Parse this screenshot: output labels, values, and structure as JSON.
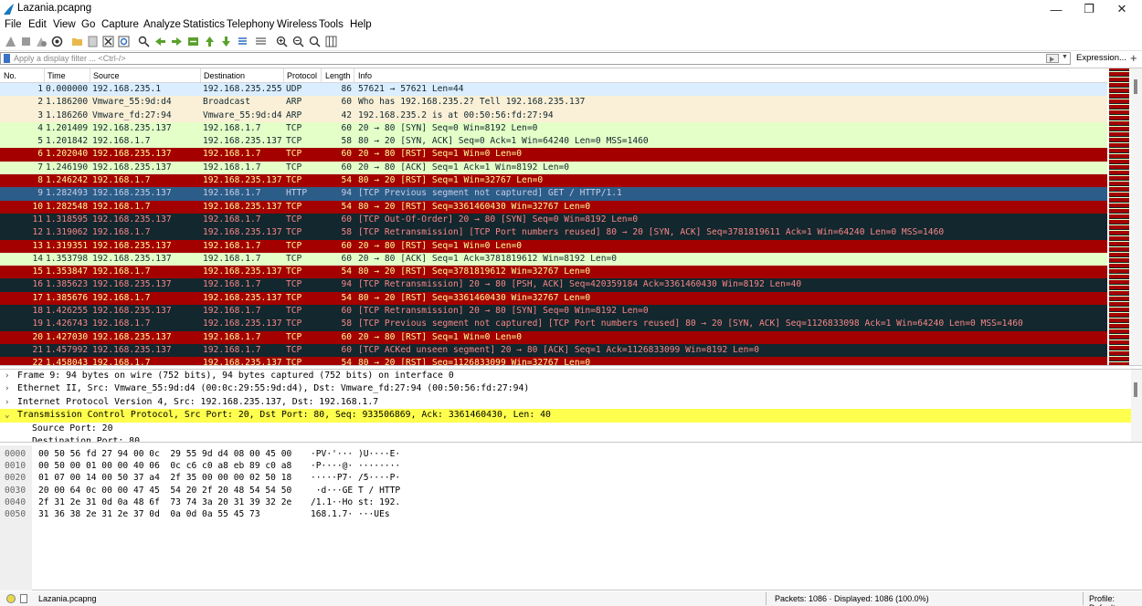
{
  "window": {
    "title": "Lazania.pcapng",
    "minimize_glyph": "—",
    "maximize_glyph": "❐",
    "close_glyph": "✕"
  },
  "menu": [
    "File",
    "Edit",
    "View",
    "Go",
    "Capture",
    "Analyze",
    "Statistics",
    "Telephony",
    "Wireless",
    "Tools",
    "Help"
  ],
  "toolbar_icons": [
    "start-capture-icon",
    "stop-capture-icon",
    "restart-capture-icon",
    "capture-options-icon",
    "open-file-icon",
    "save-file-icon",
    "close-file-icon",
    "reload-file-icon",
    "find-packet-icon",
    "go-back-icon",
    "go-forward-icon",
    "go-to-packet-icon",
    "go-first-icon",
    "go-last-icon",
    "autoscroll-icon",
    "colorize-icon",
    "zoom-in-icon",
    "zoom-out-icon",
    "normal-size-icon",
    "resize-columns-icon"
  ],
  "filter": {
    "placeholder": "Apply a display filter ... <Ctrl-/>",
    "expression_label": "Expression...",
    "plus_label": "+"
  },
  "packet_list": {
    "columns": [
      "No.",
      "Time",
      "Source",
      "Destination",
      "Protocol",
      "Length",
      "Info"
    ],
    "rows": [
      {
        "no": "1",
        "time": "0.000000",
        "src": "192.168.235.1",
        "dst": "192.168.235.255",
        "proto": "UDP",
        "len": "86",
        "info": "57621 → 57621 Len=44",
        "style": "udp"
      },
      {
        "no": "2",
        "time": "1.186200",
        "src": "Vmware_55:9d:d4",
        "dst": "Broadcast",
        "proto": "ARP",
        "len": "60",
        "info": "Who has 192.168.235.2? Tell 192.168.235.137",
        "style": "arp"
      },
      {
        "no": "3",
        "time": "1.186260",
        "src": "Vmware_fd:27:94",
        "dst": "Vmware_55:9d:d4",
        "proto": "ARP",
        "len": "42",
        "info": "192.168.235.2 is at 00:50:56:fd:27:94",
        "style": "arp"
      },
      {
        "no": "4",
        "time": "1.201409",
        "src": "192.168.235.137",
        "dst": "192.168.1.7",
        "proto": "TCP",
        "len": "60",
        "info": "20 → 80 [SYN] Seq=0 Win=8192 Len=0",
        "style": "syn"
      },
      {
        "no": "5",
        "time": "1.201842",
        "src": "192.168.1.7",
        "dst": "192.168.235.137",
        "proto": "TCP",
        "len": "58",
        "info": "80 → 20 [SYN, ACK] Seq=0 Ack=1 Win=64240 Len=0 MSS=1460",
        "style": "syn"
      },
      {
        "no": "6",
        "time": "1.202040",
        "src": "192.168.235.137",
        "dst": "192.168.1.7",
        "proto": "TCP",
        "len": "60",
        "info": "20 → 80 [RST] Seq=1 Win=0 Len=0",
        "style": "rst"
      },
      {
        "no": "7",
        "time": "1.246190",
        "src": "192.168.235.137",
        "dst": "192.168.1.7",
        "proto": "TCP",
        "len": "60",
        "info": "20 → 80 [ACK] Seq=1 Ack=1 Win=8192 Len=0",
        "style": "syn"
      },
      {
        "no": "8",
        "time": "1.246242",
        "src": "192.168.1.7",
        "dst": "192.168.235.137",
        "proto": "TCP",
        "len": "54",
        "info": "80 → 20 [RST] Seq=1 Win=32767 Len=0",
        "style": "rst"
      },
      {
        "no": "9",
        "time": "1.282493",
        "src": "192.168.235.137",
        "dst": "192.168.1.7",
        "proto": "HTTP",
        "len": "94",
        "info": "[TCP Previous segment not captured] GET / HTTP/1.1",
        "style": "sel"
      },
      {
        "no": "10",
        "time": "1.282548",
        "src": "192.168.1.7",
        "dst": "192.168.235.137",
        "proto": "TCP",
        "len": "54",
        "info": "80 → 20 [RST] Seq=3361460430 Win=32767 Len=0",
        "style": "rst"
      },
      {
        "no": "11",
        "time": "1.318595",
        "src": "192.168.235.137",
        "dst": "192.168.1.7",
        "proto": "TCP",
        "len": "60",
        "info": "[TCP Out-Of-Order] 20 → 80 [SYN] Seq=0 Win=8192 Len=0",
        "style": "bad"
      },
      {
        "no": "12",
        "time": "1.319062",
        "src": "192.168.1.7",
        "dst": "192.168.235.137",
        "proto": "TCP",
        "len": "58",
        "info": "[TCP Retransmission] [TCP Port numbers reused] 80 → 20 [SYN, ACK] Seq=3781819611 Ack=1 Win=64240 Len=0 MSS=1460",
        "style": "bad"
      },
      {
        "no": "13",
        "time": "1.319351",
        "src": "192.168.235.137",
        "dst": "192.168.1.7",
        "proto": "TCP",
        "len": "60",
        "info": "20 → 80 [RST] Seq=1 Win=0 Len=0",
        "style": "rst"
      },
      {
        "no": "14",
        "time": "1.353798",
        "src": "192.168.235.137",
        "dst": "192.168.1.7",
        "proto": "TCP",
        "len": "60",
        "info": "20 → 80 [ACK] Seq=1 Ack=3781819612 Win=8192 Len=0",
        "style": "syn"
      },
      {
        "no": "15",
        "time": "1.353847",
        "src": "192.168.1.7",
        "dst": "192.168.235.137",
        "proto": "TCP",
        "len": "54",
        "info": "80 → 20 [RST] Seq=3781819612 Win=32767 Len=0",
        "style": "rst"
      },
      {
        "no": "16",
        "time": "1.385623",
        "src": "192.168.235.137",
        "dst": "192.168.1.7",
        "proto": "TCP",
        "len": "94",
        "info": "[TCP Retransmission] 20 → 80 [PSH, ACK] Seq=420359184 Ack=3361460430 Win=8192 Len=40",
        "style": "bad"
      },
      {
        "no": "17",
        "time": "1.385676",
        "src": "192.168.1.7",
        "dst": "192.168.235.137",
        "proto": "TCP",
        "len": "54",
        "info": "80 → 20 [RST] Seq=3361460430 Win=32767 Len=0",
        "style": "rst"
      },
      {
        "no": "18",
        "time": "1.426255",
        "src": "192.168.235.137",
        "dst": "192.168.1.7",
        "proto": "TCP",
        "len": "60",
        "info": "[TCP Retransmission] 20 → 80 [SYN] Seq=0 Win=8192 Len=0",
        "style": "bad"
      },
      {
        "no": "19",
        "time": "1.426743",
        "src": "192.168.1.7",
        "dst": "192.168.235.137",
        "proto": "TCP",
        "len": "58",
        "info": "[TCP Previous segment not captured] [TCP Port numbers reused] 80 → 20 [SYN, ACK] Seq=1126833098 Ack=1 Win=64240 Len=0 MSS=1460",
        "style": "bad"
      },
      {
        "no": "20",
        "time": "1.427030",
        "src": "192.168.235.137",
        "dst": "192.168.1.7",
        "proto": "TCP",
        "len": "60",
        "info": "20 → 80 [RST] Seq=1 Win=0 Len=0",
        "style": "rst"
      },
      {
        "no": "21",
        "time": "1.457992",
        "src": "192.168.235.137",
        "dst": "192.168.1.7",
        "proto": "TCP",
        "len": "60",
        "info": "[TCP ACKed unseen segment] 20 → 80 [ACK] Seq=1 Ack=1126833099 Win=8192 Len=0",
        "style": "bad"
      },
      {
        "no": "22",
        "time": "1.458043",
        "src": "192.168.1.7",
        "dst": "192.168.235.137",
        "proto": "TCP",
        "len": "54",
        "info": "80 → 20 [RST] Seq=1126833099 Win=32767 Len=0",
        "style": "rst"
      }
    ]
  },
  "details": [
    {
      "text": "Frame 9: 94 bytes on wire (752 bits), 94 bytes captured (752 bits) on interface 0",
      "twisty": "›",
      "level": 0,
      "highlight": false
    },
    {
      "text": "Ethernet II, Src: Vmware_55:9d:d4 (00:0c:29:55:9d:d4), Dst: Vmware_fd:27:94 (00:50:56:fd:27:94)",
      "twisty": "›",
      "level": 0,
      "highlight": false
    },
    {
      "text": "Internet Protocol Version 4, Src: 192.168.235.137, Dst: 192.168.1.7",
      "twisty": "›",
      "level": 0,
      "highlight": false
    },
    {
      "text": "Transmission Control Protocol, Src Port: 20, Dst Port: 80, Seq: 933506869, Ack: 3361460430, Len: 40",
      "twisty": "⌄",
      "level": 0,
      "highlight": true
    },
    {
      "text": "Source Port: 20",
      "twisty": "",
      "level": 1,
      "highlight": false
    },
    {
      "text": "Destination Port: 80",
      "twisty": "",
      "level": 1,
      "highlight": false
    }
  ],
  "bytes": [
    {
      "offset": "0000",
      "hex": "00 50 56 fd 27 94 00 0c  29 55 9d d4 08 00 45 00",
      "ascii": "·PV·'··· )U····E·"
    },
    {
      "offset": "0010",
      "hex": "00 50 00 01 00 00 40 06  0c c6 c0 a8 eb 89 c0 a8",
      "ascii": "·P····@· ········"
    },
    {
      "offset": "0020",
      "hex": "01 07 00 14 00 50 37 a4  2f 35 00 00 00 02 50 18",
      "ascii": "·····P7· /5····P·"
    },
    {
      "offset": "0030",
      "hex": "20 00 64 0c 00 00 47 45  54 20 2f 20 48 54 54 50",
      "ascii": " ·d···GE T / HTTP"
    },
    {
      "offset": "0040",
      "hex": "2f 31 2e 31 0d 0a 48 6f  73 74 3a 20 31 39 32 2e",
      "ascii": "/1.1··Ho st: 192."
    },
    {
      "offset": "0050",
      "hex": "31 36 38 2e 31 2e 37 0d  0a 0d 0a 55 45 73",
      "ascii": "168.1.7· ···UEs"
    }
  ],
  "status": {
    "file": "Lazania.pcapng",
    "packets": "Packets: 1086 · Displayed: 1086 (100.0%)",
    "profile": "Profile: Default"
  }
}
